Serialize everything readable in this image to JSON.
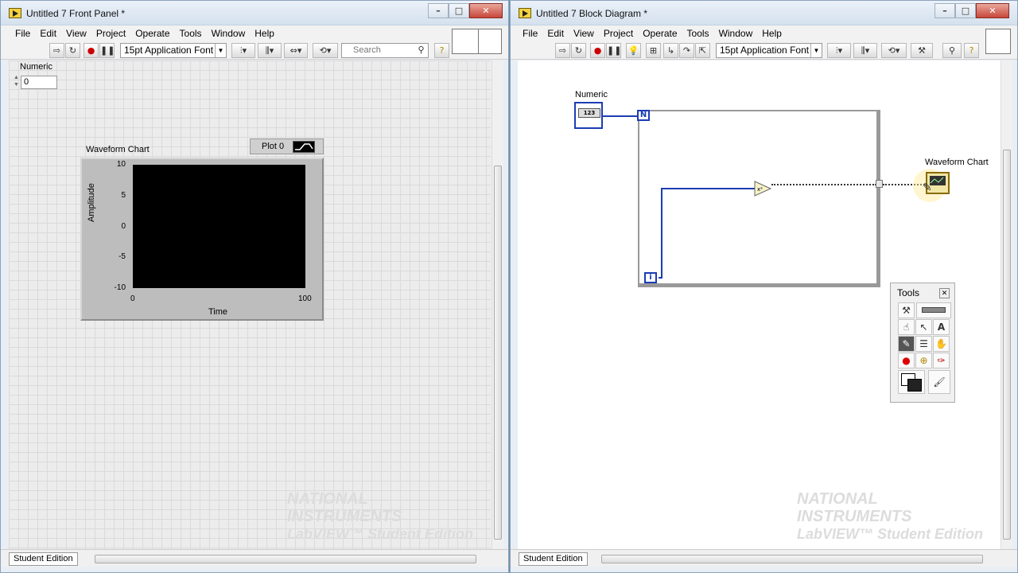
{
  "front_panel": {
    "title": "Untitled 7 Front Panel *",
    "menu": [
      "File",
      "Edit",
      "View",
      "Project",
      "Operate",
      "Tools",
      "Window",
      "Help"
    ],
    "font_select": "15pt Application Font",
    "search_placeholder": "Search",
    "numeric": {
      "label": "Numeric",
      "value": "0"
    },
    "chart": {
      "title": "Waveform Chart",
      "plot_legend": "Plot 0"
    },
    "status": "Student Edition"
  },
  "block_diagram": {
    "title": "Untitled 7 Block Diagram *",
    "menu": [
      "File",
      "Edit",
      "View",
      "Project",
      "Operate",
      "Tools",
      "Window",
      "Help"
    ],
    "font_select": "15pt Application Font",
    "numeric_label": "Numeric",
    "numeric_terminal": "123",
    "count_terminal": "N",
    "iteration_terminal": "i",
    "chart_label": "Waveform Chart",
    "tools_title": "Tools",
    "status": "Student Edition"
  },
  "chart_data": {
    "type": "line",
    "title": "Waveform Chart",
    "xlabel": "Time",
    "ylabel": "Amplitude",
    "xlim": [
      0,
      100
    ],
    "ylim": [
      -10,
      10
    ],
    "x_ticks": [
      "0",
      "100"
    ],
    "y_ticks": [
      "10",
      "5",
      "0",
      "-5",
      "-10"
    ],
    "series": [
      {
        "name": "Plot 0",
        "values": []
      }
    ],
    "background": "#000000",
    "grid": false,
    "legend": "top-right"
  },
  "watermark": {
    "line1": "NATIONAL",
    "line2": "INSTRUMENTS",
    "line3": "LabVIEW™ Student Edition"
  },
  "colors": {
    "wire_blue": "#1b3db3",
    "chart_bg": "#000000",
    "frame": "#bdbdbd"
  }
}
